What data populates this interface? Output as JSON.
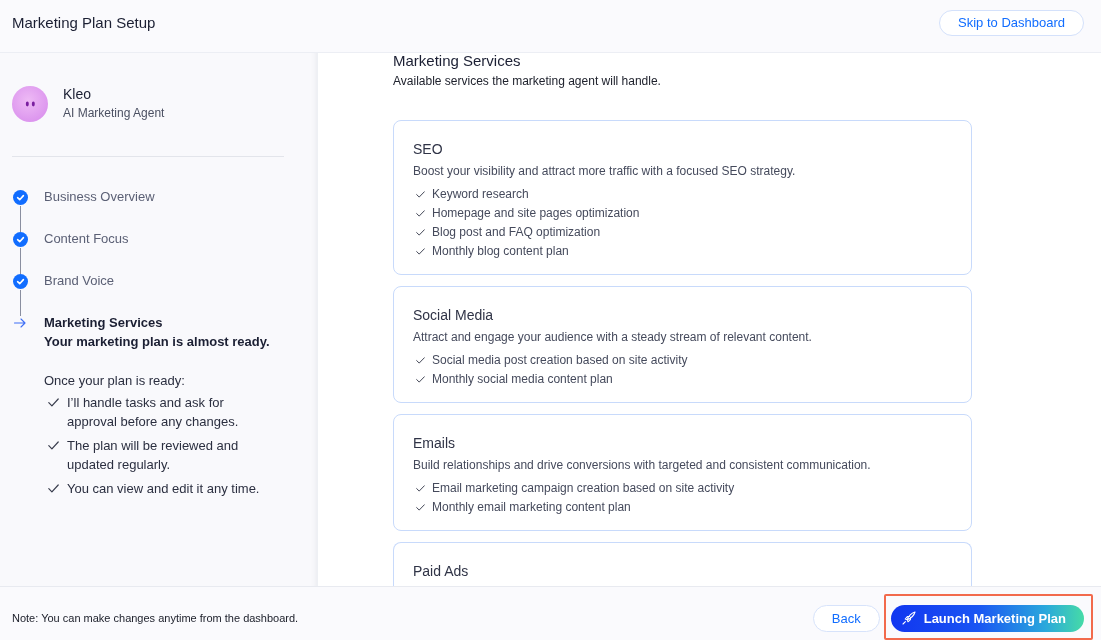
{
  "header": {
    "title": "Marketing Plan Setup",
    "skip_button": "Skip to Dashboard"
  },
  "agent": {
    "name": "Kleo",
    "role": "AI Marketing Agent"
  },
  "steps": [
    {
      "label": "Business Overview",
      "completed": true,
      "selected": false
    },
    {
      "label": "Content Focus",
      "completed": true,
      "selected": false
    },
    {
      "label": "Brand Voice",
      "completed": true,
      "selected": false
    },
    {
      "label": "Marketing Services",
      "completed": false,
      "selected": true,
      "note": "Your marketing plan is almost ready."
    }
  ],
  "plan_info": {
    "intro": "Once your plan is ready:",
    "points": [
      "I’ll handle tasks and ask for approval before any changes.",
      "The plan will be reviewed and updated regularly.",
      "You can view and edit it any time."
    ]
  },
  "services": {
    "title": "Marketing Services",
    "subtitle": "Available services the marketing agent will handle.",
    "cards": [
      {
        "title": "SEO",
        "description": "Boost your visibility and attract more traffic with a focused SEO strategy.",
        "features": [
          "Keyword research",
          "Homepage and site pages optimization",
          "Blog post and FAQ optimization",
          "Monthly blog content plan"
        ]
      },
      {
        "title": "Social Media",
        "description": "Attract and engage your audience with a steady stream of relevant content.",
        "features": [
          "Social media post creation based on site activity",
          "Monthly social media content plan"
        ]
      },
      {
        "title": "Emails",
        "description": "Build relationships and drive conversions with targeted and consistent communication.",
        "features": [
          "Email marketing campaign creation based on site activity",
          "Monthly email marketing content plan"
        ]
      },
      {
        "title": "Paid Ads"
      }
    ]
  },
  "footer": {
    "note": "Note: You can make changes anytime from the dashboard.",
    "back_button": "Back",
    "launch_button": {
      "label": "Launch Marketing Plan",
      "highlighted": true
    }
  }
}
